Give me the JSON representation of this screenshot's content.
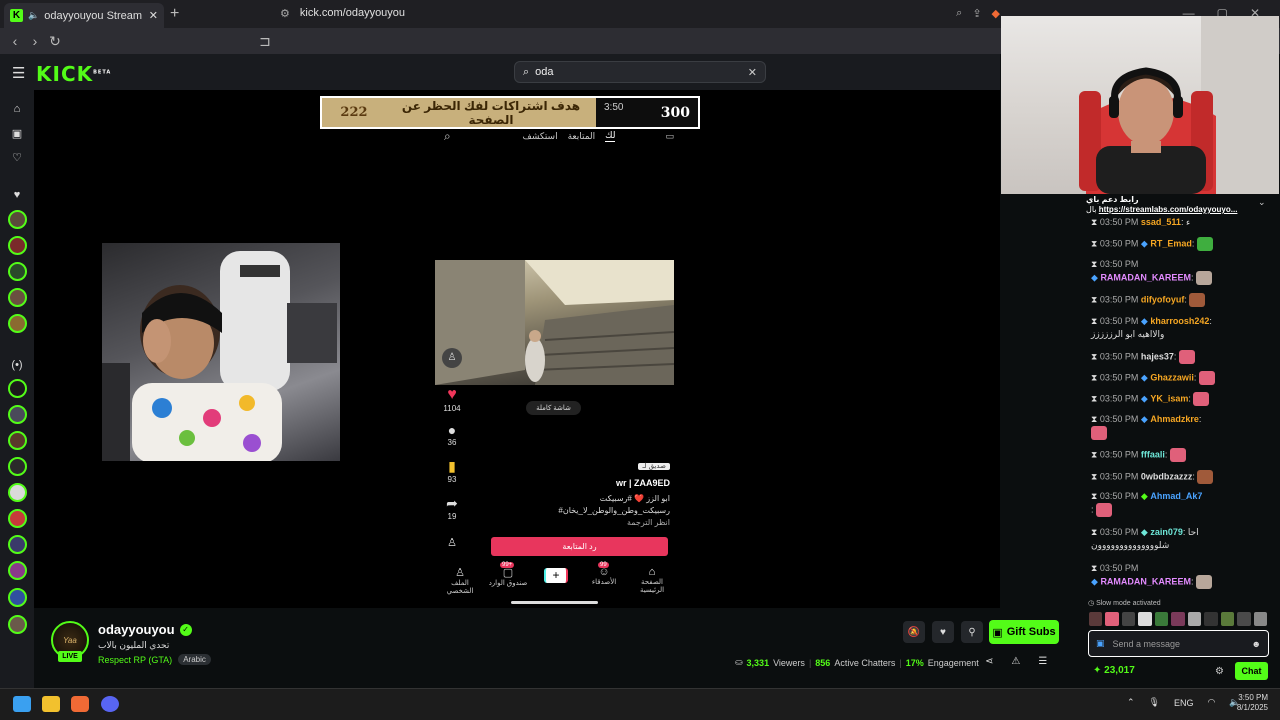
{
  "browser": {
    "tab_title": "odayyouyou Stream - Watch",
    "url": "kick.com/odayyouyou"
  },
  "header": {
    "logo": "KICK",
    "logo_badge": "BETA",
    "search_value": "oda"
  },
  "video": {
    "goal_left": "222",
    "goal_text": "هدف اشتراكات لفك الحظر عن الصفحة",
    "goal_time": "3:50",
    "goal_right": "300",
    "tiktok_tabs": [
      "استكشف",
      "المتابعة",
      "لك"
    ],
    "likes": "1104",
    "comments": "36",
    "saves": "93",
    "shares": "19",
    "fullscreen_label": "شاشة كاملة",
    "tag_label": "صديق لـ",
    "author": "wr | ZAA9ED",
    "caption_1": "ابو الزز ❤️ #رسبيكت",
    "caption_2": "#رسبيكت_وطن_والوطن_لا_يخان",
    "see_translation": "انظر الترجمة",
    "follow_back": "رد المتابعة",
    "nav_profile": "الملف الشخصي",
    "nav_inbox": "صندوق الوارد",
    "nav_friends": "الأصدقاء",
    "nav_home": "الصفحة الرئيسية",
    "inbox_badge": "99+",
    "friends_badge": "99"
  },
  "stream": {
    "channel": "odayyouyou",
    "title": "تحدي المليون بالاب",
    "category": "Respect RP (GTA)",
    "tag": "Arabic",
    "live": "LIVE",
    "gift_label": "Gift Subs",
    "viewers": "3,331",
    "viewers_label": "Viewers",
    "chatters": "856",
    "chatters_label": "Active Chatters",
    "engagement": "17%",
    "engagement_label": "Engagement",
    "avatar_text": "Yaa"
  },
  "chat": {
    "pinned_title": "رابط دعم باي",
    "pinned_prefix": "بال",
    "pinned_link": "https://streamlabs.com/odayyouyo...",
    "messages": [
      {
        "time": "03:50 PM",
        "user": "ssad_511",
        "color": "#f5a623",
        "text": "ء"
      },
      {
        "time": "03:50 PM",
        "user": "RT_Emad",
        "color": "#f5a623",
        "text": ""
      },
      {
        "time": "03:50 PM",
        "user": "RAMADAN_KAREEM",
        "color": "#e38bff",
        "text": ""
      },
      {
        "time": "03:50 PM",
        "user": "difyofoyuf",
        "color": "#f5a623",
        "text": ""
      },
      {
        "time": "03:50 PM",
        "user": "kharroosh242",
        "color": "#f5a623",
        "text": "والااهيه ابو الرززززز"
      },
      {
        "time": "03:50 PM",
        "user": "hajes37",
        "color": "#dddddd",
        "text": ""
      },
      {
        "time": "03:50 PM",
        "user": "Ghazzawii",
        "color": "#f5a623",
        "text": ""
      },
      {
        "time": "03:50 PM",
        "user": "YK_isam",
        "color": "#f5a623",
        "text": ""
      },
      {
        "time": "03:50 PM",
        "user": "Ahmadzkre",
        "color": "#f5a623",
        "text": ""
      },
      {
        "time": "03:50 PM",
        "user": "fffaali",
        "color": "#6ee7d8",
        "text": ""
      },
      {
        "time": "03:50 PM",
        "user": "0wbdbzazzz",
        "color": "#dddddd",
        "text": ""
      },
      {
        "time": "03:50 PM",
        "user": "Ahmad_Ak7",
        "color": "#4aa3ff",
        "text": ""
      },
      {
        "time": "03:50 PM",
        "user": "zain079",
        "color": "#6ee7d8",
        "text": "احا شلوووووووووووووون"
      },
      {
        "time": "03:50 PM",
        "user": "RAMADAN_KAREEM",
        "color": "#e38bff",
        "text": ""
      }
    ],
    "slow_mode": "Slow mode activated",
    "input_placeholder": "Send a message",
    "points": "23,017",
    "chat_button": "Chat"
  },
  "taskbar": {
    "lang": "ENG",
    "time": "3:50 PM",
    "date": "8/1/2025"
  },
  "colors": {
    "accent": "#53fc18",
    "tiktok_red": "#e8365d",
    "goal_bg": "#c8b07c"
  }
}
